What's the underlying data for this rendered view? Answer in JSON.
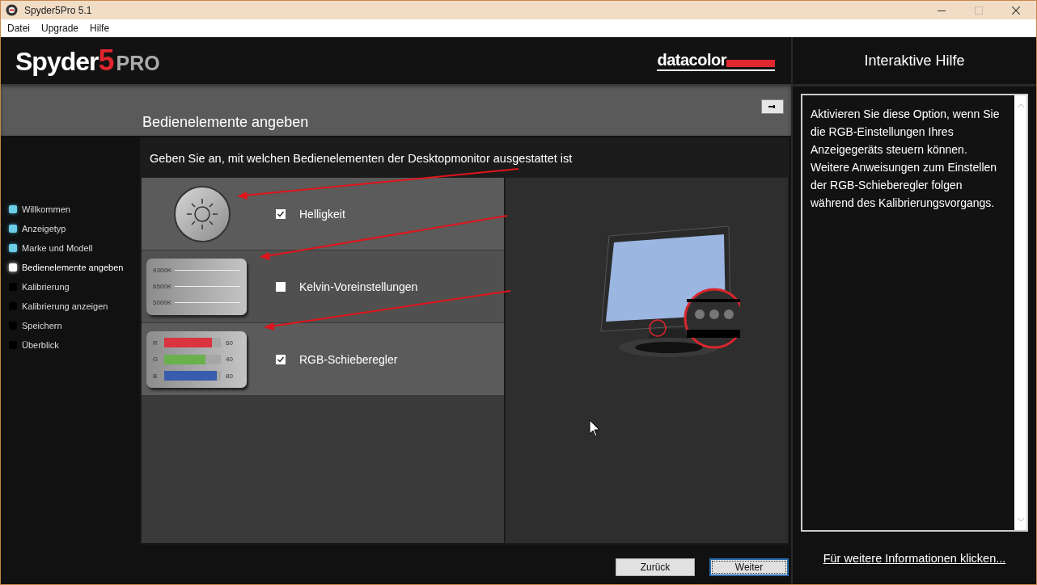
{
  "window": {
    "title": "Spyder5Pro 5.1"
  },
  "menu": [
    "Datei",
    "Upgrade",
    "Hilfe"
  ],
  "logo": {
    "word": "Spyder",
    "number": "5",
    "suffix": "PRO"
  },
  "brand": "datacolor",
  "page_title": "Bedienelemente angeben",
  "steps": [
    {
      "label": "Willkommen",
      "completed": true,
      "selected": false
    },
    {
      "label": "Anzeigetyp",
      "completed": true,
      "selected": false
    },
    {
      "label": "Marke und Modell",
      "completed": true,
      "selected": false
    },
    {
      "label": "Bedienelemente angeben",
      "completed": false,
      "selected": true
    },
    {
      "label": "Kalibrierung",
      "completed": false,
      "selected": false
    },
    {
      "label": "Kalibrierung anzeigen",
      "completed": false,
      "selected": false
    },
    {
      "label": "Speichern",
      "completed": false,
      "selected": false
    },
    {
      "label": "Überblick",
      "completed": false,
      "selected": false
    }
  ],
  "instruction": "Geben Sie an, mit welchen Bedienelementen der Desktopmonitor ausgestattet ist",
  "controls": [
    {
      "kind": "brightness",
      "label": "Helligkeit",
      "checked": true
    },
    {
      "kind": "kelvin",
      "label": "Kelvin-Voreinstellungen",
      "checked": false,
      "presets": [
        "9300K",
        "6500K",
        "5000K"
      ]
    },
    {
      "kind": "rgb",
      "label": "RGB-Schieberegler",
      "checked": true,
      "sliders": [
        {
          "channel": "R",
          "value": "60",
          "level": 0.84,
          "color": "#d9343f"
        },
        {
          "channel": "G",
          "value": "40",
          "level": 0.73,
          "color": "#6ab04c"
        },
        {
          "channel": "B",
          "value": "80",
          "level": 0.93,
          "color": "#3a5cae"
        }
      ]
    }
  ],
  "buttons": [
    {
      "label": "Zurück",
      "focused": false
    },
    {
      "label": "Weiter",
      "focused": true
    }
  ],
  "help": {
    "title": "Interaktive Hilfe",
    "text": "Aktivieren Sie diese Option, wenn Sie die RGB-Einstellungen Ihres Anzeigegeräts steuern können. Weitere Anweisungen zum Einstellen der RGB-Schieberegler folgen während des Kalibrierungsvorgangs.",
    "link": "Für weitere Informationen klicken..."
  }
}
